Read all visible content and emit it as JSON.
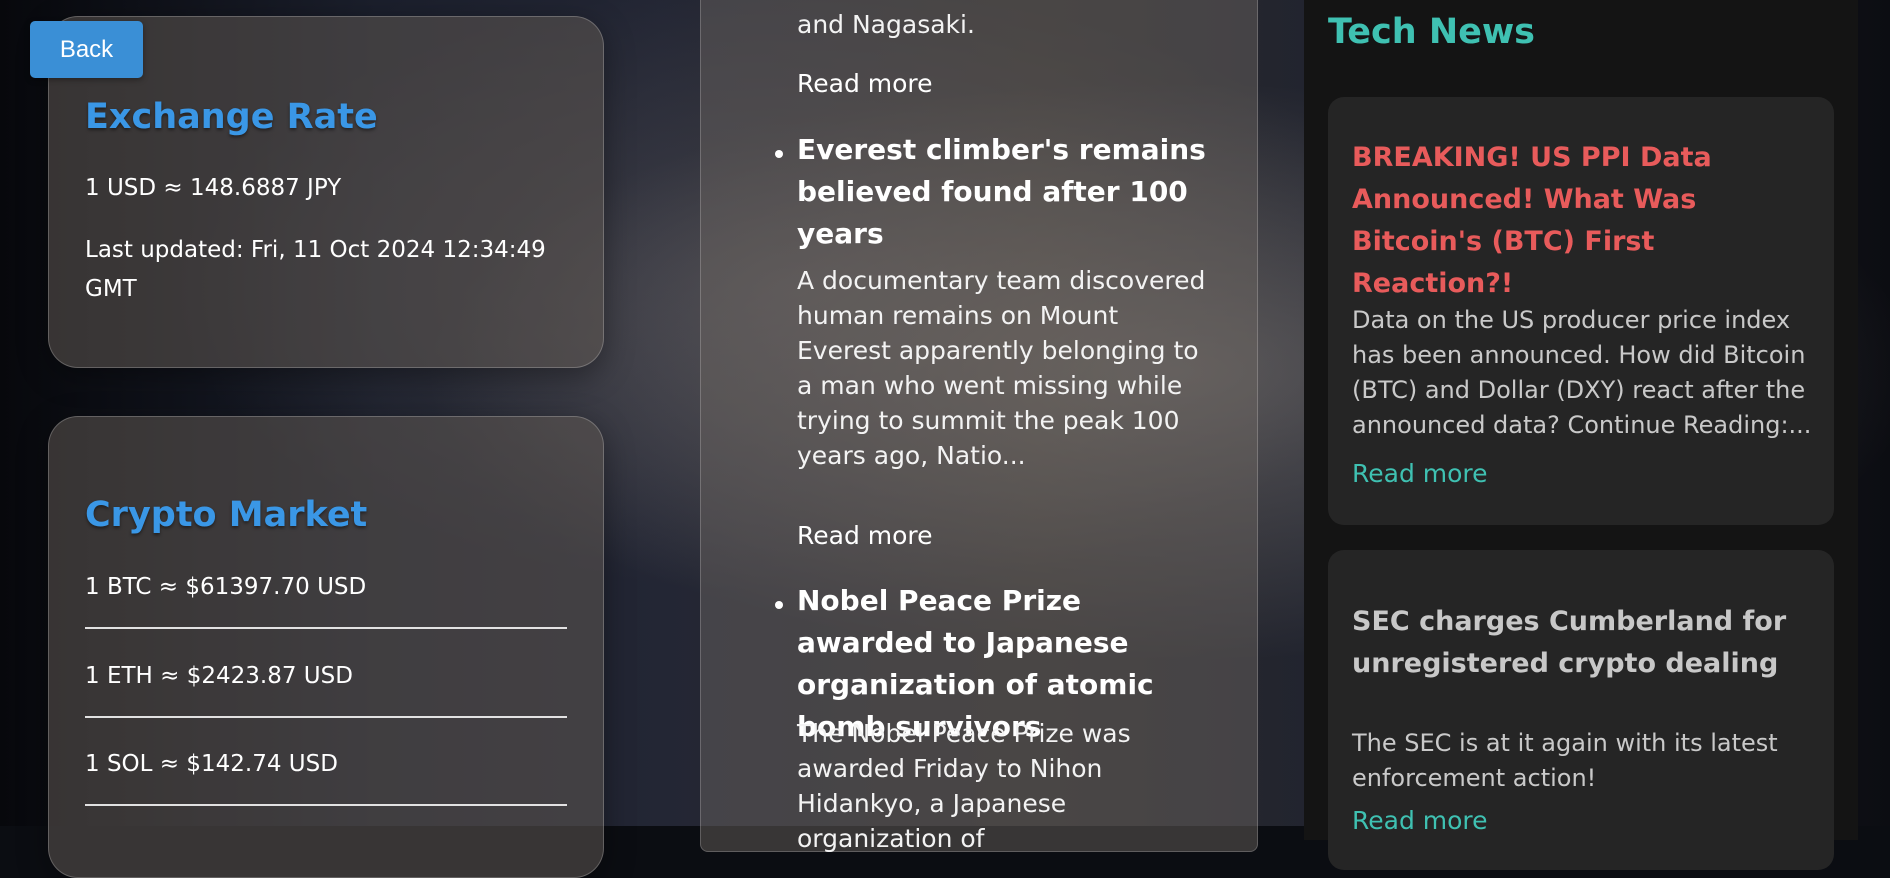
{
  "back_button": {
    "label": "Back"
  },
  "exchange": {
    "title": "Exchange Rate",
    "rate": "1 USD ≈ 148.6887 JPY",
    "last_updated": "Last updated: Fri, 11 Oct 2024 12:34:49 GMT"
  },
  "crypto": {
    "title": "Crypto Market",
    "rows": [
      "1 BTC ≈ $61397.70 USD",
      "1 ETH ≈ $2423.87 USD",
      "1 SOL ≈ $142.74 USD"
    ]
  },
  "news": {
    "prev_tail": "and Nagasaki.",
    "prev_read_more": "Read more",
    "items": [
      {
        "headline": "Everest climber's remains believed found after 100 years",
        "summary": "A documentary team discovered human remains on Mount Everest apparently belonging to a man who went missing while trying to summit the peak 100 years ago, Natio...",
        "read_more": "Read more"
      },
      {
        "headline": "Nobel Peace Prize awarded to Japanese organization of atomic bomb survivors",
        "summary": "The Nobel Peace Prize was awarded Friday to Nihon Hidankyo, a Japanese organization of",
        "read_more": ""
      }
    ]
  },
  "tech_news": {
    "title": "Tech News",
    "items": [
      {
        "headline": "BREAKING! US PPI Data Announced! What Was Bitcoin's (BTC) First Reaction?!",
        "description": "Data on the US producer price index has been announced. How did Bitcoin (BTC) and Dollar (DXY) react after the announced data? Continue Reading:...",
        "read_more": "Read more",
        "headline_color": "#e85b5b"
      },
      {
        "headline": "SEC charges Cumberland for unregistered crypto dealing",
        "description": "The SEC is at it again with its latest enforcement action!",
        "read_more": "Read more",
        "headline_color": "#c8c8c8"
      }
    ]
  },
  "colors": {
    "accent_blue": "#3a97e6",
    "accent_teal": "#3fc1b2",
    "breaking_red": "#e85b5b"
  }
}
